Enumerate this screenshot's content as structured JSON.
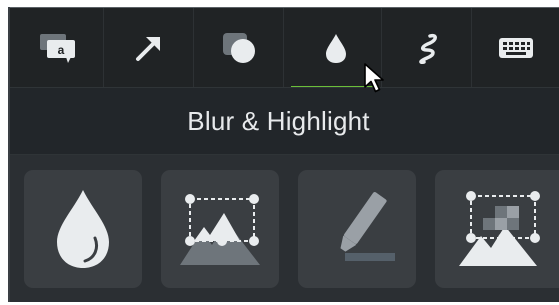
{
  "toolbar": {
    "tabs": [
      {
        "id": "annotations",
        "icon": "callout-icon",
        "active": false
      },
      {
        "id": "arrows",
        "icon": "arrow-icon",
        "active": false
      },
      {
        "id": "shapes",
        "icon": "shapes-icon",
        "active": false
      },
      {
        "id": "blur-highlight",
        "icon": "droplet-icon",
        "active": true
      },
      {
        "id": "sketch-motion",
        "icon": "squiggle-icon",
        "active": false
      },
      {
        "id": "keystroke",
        "icon": "keyboard-icon",
        "active": false
      }
    ],
    "callout_glyph": "a",
    "active_color": "#6bbf3a"
  },
  "header": {
    "title": "Blur & Highlight"
  },
  "tiles": [
    {
      "id": "blur",
      "icon": "droplet-icon"
    },
    {
      "id": "spotlight",
      "icon": "spotlight-icon"
    },
    {
      "id": "highlight",
      "icon": "highlighter-icon"
    },
    {
      "id": "pixelate",
      "icon": "pixelate-icon"
    }
  ],
  "colors": {
    "panel": "#2a2e32",
    "toolbar": "#202325",
    "tile": "#3a3e42",
    "icon": "#e9ecee",
    "accent": "#6bbf3a"
  }
}
